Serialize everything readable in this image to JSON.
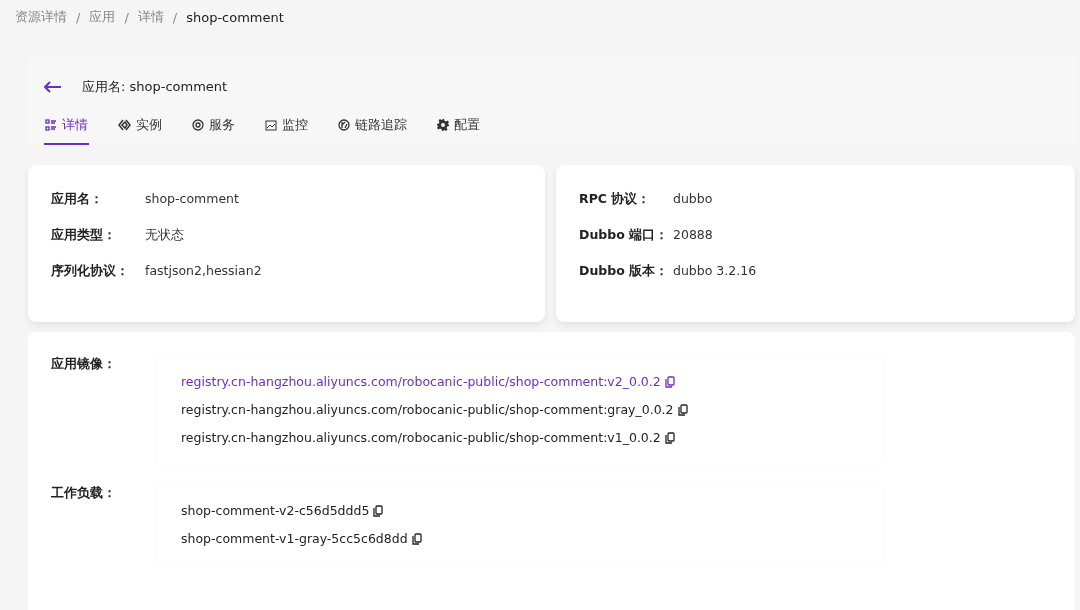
{
  "breadcrumb": [
    "资源详情",
    "应用",
    "详情",
    "shop-comment"
  ],
  "breadcrumb_separator": "/",
  "header": {
    "title": "应用名: shop-comment"
  },
  "tabs": [
    {
      "label": "详情",
      "selected": true
    },
    {
      "label": "实例",
      "selected": false
    },
    {
      "label": "服务",
      "selected": false
    },
    {
      "label": "监控",
      "selected": false
    },
    {
      "label": "链路追踪",
      "selected": false
    },
    {
      "label": "配置",
      "selected": false
    }
  ],
  "basic_info": [
    {
      "label": "应用名：",
      "value": "shop-comment"
    },
    {
      "label": "应用类型：",
      "value": "无状态"
    },
    {
      "label": "序列化协议：",
      "value": "fastjson2,hessian2"
    }
  ],
  "protocol_info": [
    {
      "label": "RPC 协议：",
      "value": "dubbo"
    },
    {
      "label": "Dubbo 端口：",
      "value": "20888"
    },
    {
      "label": "Dubbo 版本：",
      "value": "dubbo 3.2.16"
    }
  ],
  "images": {
    "label": "应用镜像：",
    "items": [
      {
        "text": "registry.cn-hangzhou.aliyuncs.com/robocanic-public/shop-comment:v2_0.0.2",
        "selected": true
      },
      {
        "text": "registry.cn-hangzhou.aliyuncs.com/robocanic-public/shop-comment:gray_0.0.2",
        "selected": false
      },
      {
        "text": "registry.cn-hangzhou.aliyuncs.com/robocanic-public/shop-comment:v1_0.0.2",
        "selected": false
      }
    ]
  },
  "workloads": {
    "label": "工作负载：",
    "items": [
      {
        "text": "shop-comment-v2-c56d5ddd5",
        "selected": false
      },
      {
        "text": "shop-comment-v1-gray-5cc5c6d8dd",
        "selected": false
      }
    ]
  }
}
